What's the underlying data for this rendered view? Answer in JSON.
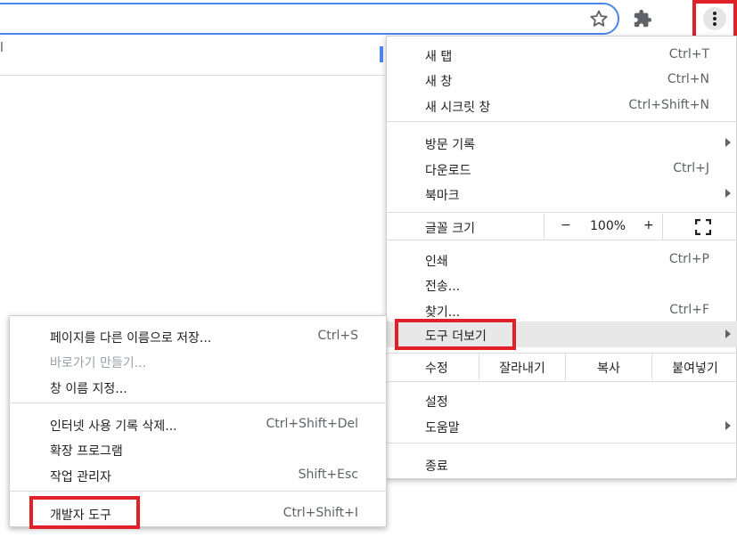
{
  "toolbar": {
    "icons": [
      "bookmark-star-icon",
      "extensions-puzzle-icon",
      "kebab-menu-icon"
    ],
    "partial_text": "l"
  },
  "menu": {
    "group1": [
      {
        "label": "새 탭",
        "shortcut": "Ctrl+T"
      },
      {
        "label": "새 창",
        "shortcut": "Ctrl+N"
      },
      {
        "label": "새 시크릿 창",
        "shortcut": "Ctrl+Shift+N"
      }
    ],
    "group2": [
      {
        "label": "방문 기록",
        "shortcut": ""
      },
      {
        "label": "다운로드",
        "shortcut": "Ctrl+J"
      },
      {
        "label": "북마크",
        "shortcut": ""
      }
    ],
    "zoom": {
      "label": "글꼴 크기",
      "minus": "−",
      "value": "100%",
      "plus": "+"
    },
    "group3": [
      {
        "label": "인쇄",
        "shortcut": "Ctrl+P"
      },
      {
        "label": "전송...",
        "shortcut": ""
      },
      {
        "label": "찾기...",
        "shortcut": "Ctrl+F"
      },
      {
        "label": "도구 더보기",
        "shortcut": ""
      }
    ],
    "edit": {
      "label": "수정",
      "cut": "잘라내기",
      "copy": "복사",
      "paste": "붙여넣기"
    },
    "group4": [
      {
        "label": "설정"
      },
      {
        "label": "도움말"
      }
    ],
    "exit": "종료"
  },
  "submenu": {
    "group1": [
      {
        "label": "페이지를 다른 이름으로 저장...",
        "shortcut": "Ctrl+S"
      },
      {
        "label": "바로가기 만들기...",
        "shortcut": ""
      },
      {
        "label": "창 이름 지정...",
        "shortcut": ""
      }
    ],
    "group2": [
      {
        "label": "인터넷 사용 기록 삭제...",
        "shortcut": "Ctrl+Shift+Del"
      },
      {
        "label": "확장 프로그램",
        "shortcut": ""
      },
      {
        "label": "작업 관리자",
        "shortcut": "Shift+Esc"
      }
    ],
    "group3": [
      {
        "label": "개발자 도구",
        "shortcut": "Ctrl+Shift+I"
      }
    ]
  },
  "colors": {
    "highlight": "#e02128",
    "accent": "#4a86f0"
  }
}
